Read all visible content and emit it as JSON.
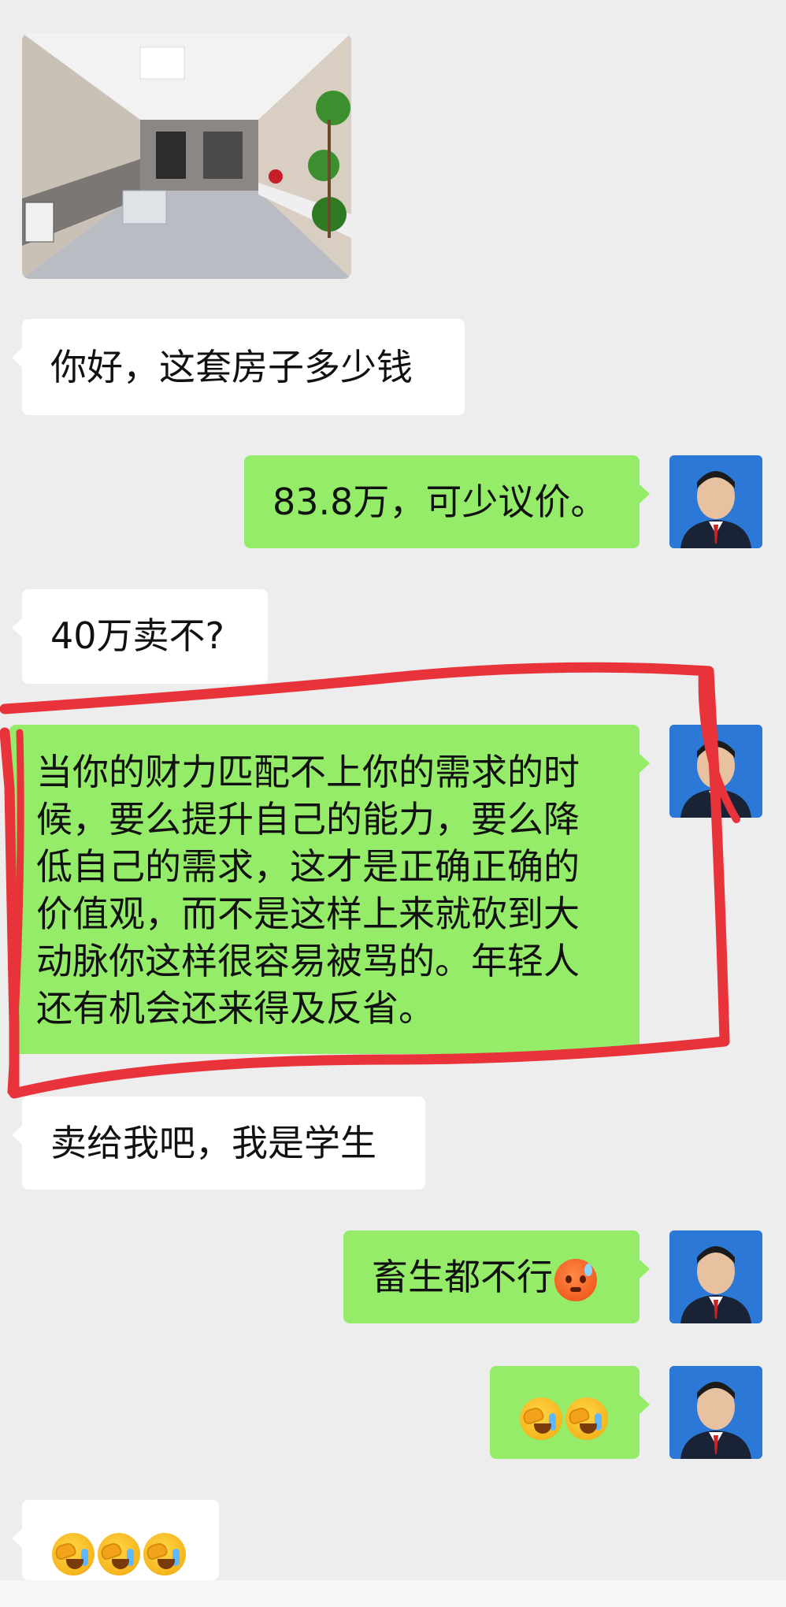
{
  "messages": {
    "m1_in": "你好，这套房子多少钱",
    "m2_out": "83.8万，可少议价。",
    "m3_in": "40万卖不?",
    "m4_out_lines": [
      "当你的财力匹配不上你的需求的时",
      "候，要么提升自己的能力，要么降",
      "低自己的需求，这才是正确正确的",
      "价值观，而不是这样上来就砍到大",
      "动脉你这样很容易被骂的。年轻人",
      "还有机会还来得及反省。"
    ],
    "m5_in": "卖给我吧，我是学生",
    "m6_out": "畜生都不行"
  },
  "colors": {
    "background": "#ededed",
    "incoming_bubble": "#ffffff",
    "outgoing_bubble": "#95ec69",
    "highlight_stroke": "#e8333a"
  },
  "icons": {
    "emoji_face_palm": "face-with-hand-over-eyes",
    "emoji_sweat": "anxious-face-with-sweat"
  }
}
